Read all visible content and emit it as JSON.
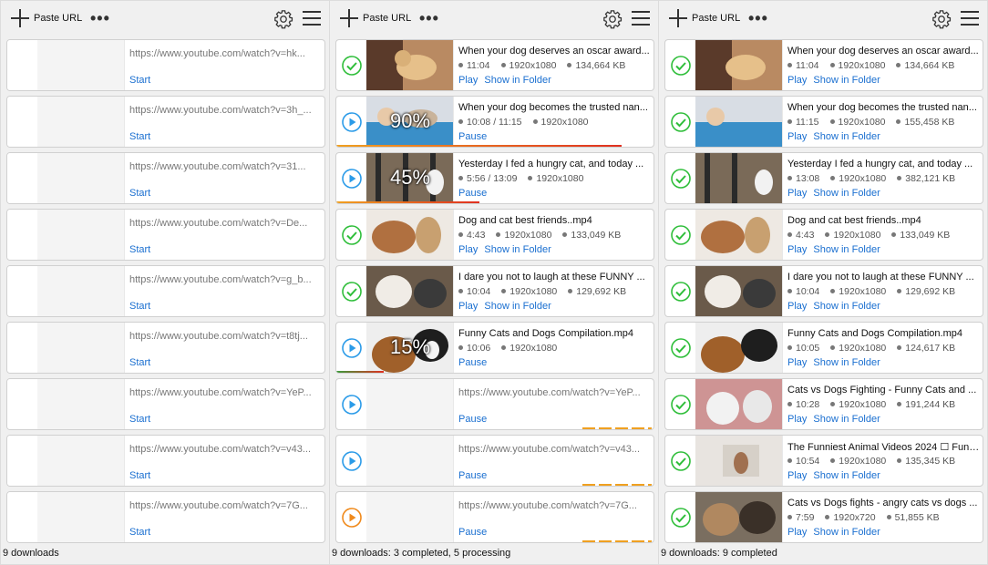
{
  "toolbar": {
    "paste_label": "Paste URL",
    "more_label": "•••"
  },
  "panes": [
    {
      "status": "9 downloads",
      "items": [
        {
          "url": "https://www.youtube.com/watch?v=hk...",
          "action": "Start"
        },
        {
          "url": "https://www.youtube.com/watch?v=3h_...",
          "action": "Start"
        },
        {
          "url": "https://www.youtube.com/watch?v=31...",
          "action": "Start"
        },
        {
          "url": "https://www.youtube.com/watch?v=De...",
          "action": "Start"
        },
        {
          "url": "https://www.youtube.com/watch?v=g_b...",
          "action": "Start"
        },
        {
          "url": "https://www.youtube.com/watch?v=t8tj...",
          "action": "Start"
        },
        {
          "url": "https://www.youtube.com/watch?v=YeP...",
          "action": "Start"
        },
        {
          "url": "https://www.youtube.com/watch?v=v43...",
          "action": "Start"
        },
        {
          "url": "https://www.youtube.com/watch?v=7G...",
          "action": "Start"
        }
      ]
    },
    {
      "status": "9 downloads: 3 completed, 5 processing",
      "items": [
        {
          "state": "done",
          "title": "When your dog deserves an oscar award...",
          "duration": "11:04",
          "resolution": "1920x1080",
          "size": "134,664 KB",
          "play": "Play",
          "folder": "Show in Folder"
        },
        {
          "state": "active",
          "title": "When your dog becomes the trusted nan...",
          "duration": "10:08 / 11:15",
          "resolution": "1920x1080",
          "percent": "90%",
          "progress": 0.9,
          "pause": "Pause"
        },
        {
          "state": "active",
          "title": "Yesterday I fed a hungry cat, and today ...",
          "duration": "5:56 / 13:09",
          "resolution": "1920x1080",
          "percent": "45%",
          "progress": 0.45,
          "pause": "Pause"
        },
        {
          "state": "done",
          "title": "Dog and cat best friends..mp4",
          "duration": "4:43",
          "resolution": "1920x1080",
          "size": "133,049 KB",
          "play": "Play",
          "folder": "Show in Folder"
        },
        {
          "state": "done",
          "title": "I dare you not to laugh at these FUNNY ...",
          "duration": "10:04",
          "resolution": "1920x1080",
          "size": "129,692 KB",
          "play": "Play",
          "folder": "Show in Folder"
        },
        {
          "state": "active",
          "title": "Funny Cats and Dogs Compilation.mp4",
          "duration": "10:06",
          "resolution": "1920x1080",
          "percent": "15%",
          "progress": 0.15,
          "pause": "Pause"
        },
        {
          "state": "queued",
          "url": "https://www.youtube.com/watch?v=YeP...",
          "pause": "Pause"
        },
        {
          "state": "queued",
          "url": "https://www.youtube.com/watch?v=v43...",
          "pause": "Pause"
        },
        {
          "state": "paused",
          "url": "https://www.youtube.com/watch?v=7G...",
          "pause": "Pause"
        }
      ]
    },
    {
      "status": "9 downloads: 9 completed",
      "items": [
        {
          "title": "When your dog deserves an oscar award...",
          "duration": "11:04",
          "resolution": "1920x1080",
          "size": "134,664 KB",
          "play": "Play",
          "folder": "Show in Folder"
        },
        {
          "title": "When your dog becomes the trusted nan...",
          "duration": "11:15",
          "resolution": "1920x1080",
          "size": "155,458 KB",
          "play": "Play",
          "folder": "Show in Folder"
        },
        {
          "title": "Yesterday I fed a hungry cat, and today ...",
          "duration": "13:08",
          "resolution": "1920x1080",
          "size": "382,121 KB",
          "play": "Play",
          "folder": "Show in Folder"
        },
        {
          "title": "Dog and cat best friends..mp4",
          "duration": "4:43",
          "resolution": "1920x1080",
          "size": "133,049 KB",
          "play": "Play",
          "folder": "Show in Folder"
        },
        {
          "title": "I dare you not to laugh at these FUNNY ...",
          "duration": "10:04",
          "resolution": "1920x1080",
          "size": "129,692 KB",
          "play": "Play",
          "folder": "Show in Folder"
        },
        {
          "title": "Funny Cats and Dogs Compilation.mp4",
          "duration": "10:05",
          "resolution": "1920x1080",
          "size": "124,617 KB",
          "play": "Play",
          "folder": "Show in Folder"
        },
        {
          "title": "Cats vs Dogs Fighting - Funny Cats and ...",
          "duration": "10:28",
          "resolution": "1920x1080",
          "size": "191,244 KB",
          "play": "Play",
          "folder": "Show in Folder"
        },
        {
          "title": "The Funniest Animal Videos 2024 ☐ Funn...",
          "duration": "10:54",
          "resolution": "1920x1080",
          "size": "135,345 KB",
          "play": "Play",
          "folder": "Show in Folder"
        },
        {
          "title": "Cats vs Dogs fights - angry cats vs dogs ...",
          "duration": "7:59",
          "resolution": "1920x720",
          "size": "51,855 KB",
          "play": "Play",
          "folder": "Show in Folder"
        }
      ]
    }
  ],
  "colors": {
    "done": "#2fbe3a",
    "active": "#2b9be8",
    "paused": "#f08a1c",
    "link": "#1a6fd0",
    "progress_orange": "#f0a020",
    "progress_red": "#e03020"
  }
}
